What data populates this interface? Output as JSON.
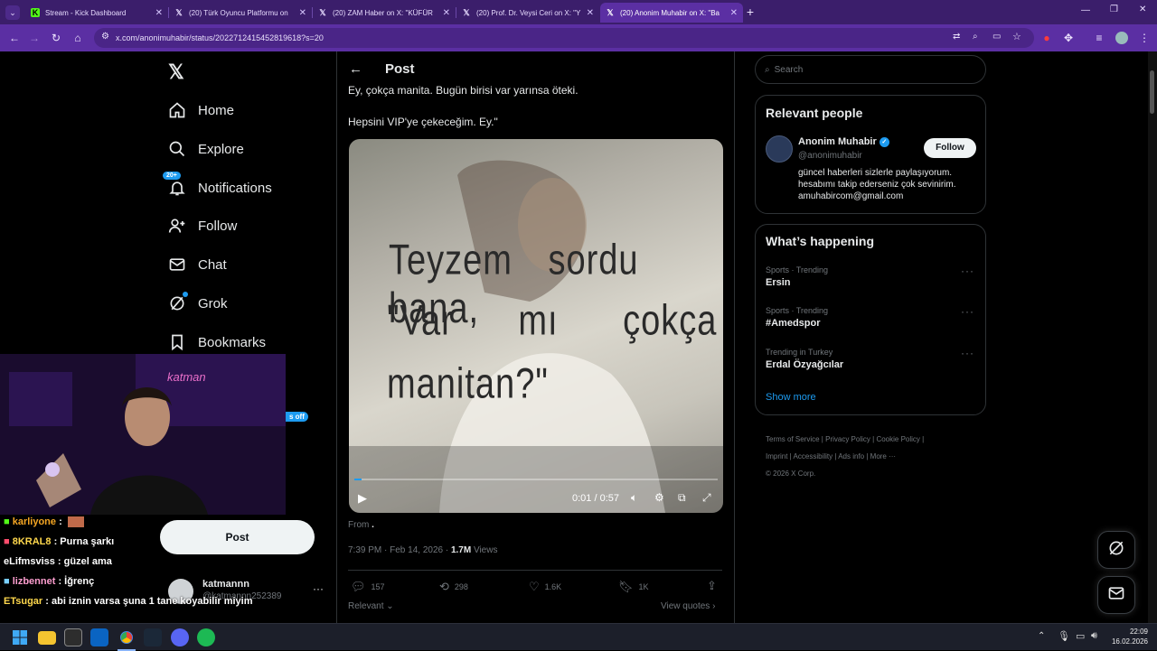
{
  "tabs": [
    {
      "title": "Stream - Kick Dashboard",
      "icon": "kick-logo-icon"
    },
    {
      "title": "(20) Türk Oyuncu Platformu on",
      "icon": "x-logo-icon"
    },
    {
      "title": "(20) ZAM Haber on X: \"KÜFÜR",
      "icon": "x-logo-icon"
    },
    {
      "title": "(20) Prof. Dr. Veysi Ceri on X: \"Y",
      "icon": "x-logo-icon"
    },
    {
      "title": "(20) Anonim Muhabir on X: \"Ba",
      "icon": "x-logo-icon"
    }
  ],
  "address": "x.com/anonimuhabir/status/2022712415452819618?s=20",
  "nav": {
    "home": "Home",
    "explore": "Explore",
    "notifications": "Notifications",
    "notif_badge": "20+",
    "follow": "Follow",
    "chat": "Chat",
    "grok": "Grok",
    "bookmarks": "Bookmarks",
    "post_button": "Post",
    "partial_badge": "s off"
  },
  "account": {
    "name": "katmannn",
    "handle": "@katmannn252389"
  },
  "chat": [
    {
      "user": "karliyone",
      "msg": "",
      "color": "#f5a623"
    },
    {
      "user": "8KRAL8",
      "msg": "Purna şarkı",
      "color": "#ffd84d"
    },
    {
      "user": "eLifmsviss",
      "msg": "güzel ama",
      "color": "#ffffff"
    },
    {
      "user": "lizbennet",
      "msg": "İğrenç",
      "color": "#ff9fd0"
    },
    {
      "user": "ETsugar",
      "msg": "abi iznin varsa şuna 1 tane koyabilir miyim",
      "color": "#ffd84d"
    }
  ],
  "post": {
    "header": "Post",
    "text_line1": "Ey, çokça manita. Bugün birisi var yarınsa öteki.",
    "text_line2": "Hepsini VIP'ye çekeceğim. Ey.\"",
    "video_caption_1": "Teyzem sordu bana,",
    "video_caption_2": "\"Var mı çokça",
    "video_caption_3": "manitan?\"",
    "video_time": "0:01 / 0:57",
    "video_progress": 0.02,
    "from_label": "From",
    "from_value": ".",
    "timestamp": "7:39 PM · Feb 14, 2026 ·",
    "views_count": "1.7M",
    "views_label": "Views",
    "replies": "157",
    "reposts": "298",
    "likes": "1.6K",
    "bookmarks": "1K",
    "relevant": "Relevant",
    "view_quotes": "View quotes"
  },
  "sidebar": {
    "search_placeholder": "Search",
    "relevant_title": "Relevant people",
    "person_name": "Anonim Muhabir",
    "person_handle": "@anonimuhabir",
    "person_bio": "güncel haberleri sizlerle paylaşıyorum. hesabımı takip ederseniz çok sevinirim. amuhabircom@gmail.com",
    "follow_label": "Follow",
    "happening_title": "What’s happening",
    "trends": [
      {
        "context": "Sports · Trending",
        "name": "Ersin"
      },
      {
        "context": "Sports · Trending",
        "name": "#Amedspor"
      },
      {
        "context": "Trending in Turkey",
        "name": "Erdal Özyağcılar"
      }
    ],
    "show_more": "Show more",
    "footer": [
      "Terms of Service",
      "Privacy Policy",
      "Cookie Policy",
      "Imprint",
      "Accessibility",
      "Ads info",
      "More ···"
    ],
    "copyright": "© 2026 X Corp."
  },
  "taskbar": {
    "time": "22:09",
    "date": "16.02.2026"
  },
  "colors": {
    "accent": "#1d9bf0",
    "browser_frame": "#5b2fa3",
    "tab_strip": "#3b1e6b"
  }
}
